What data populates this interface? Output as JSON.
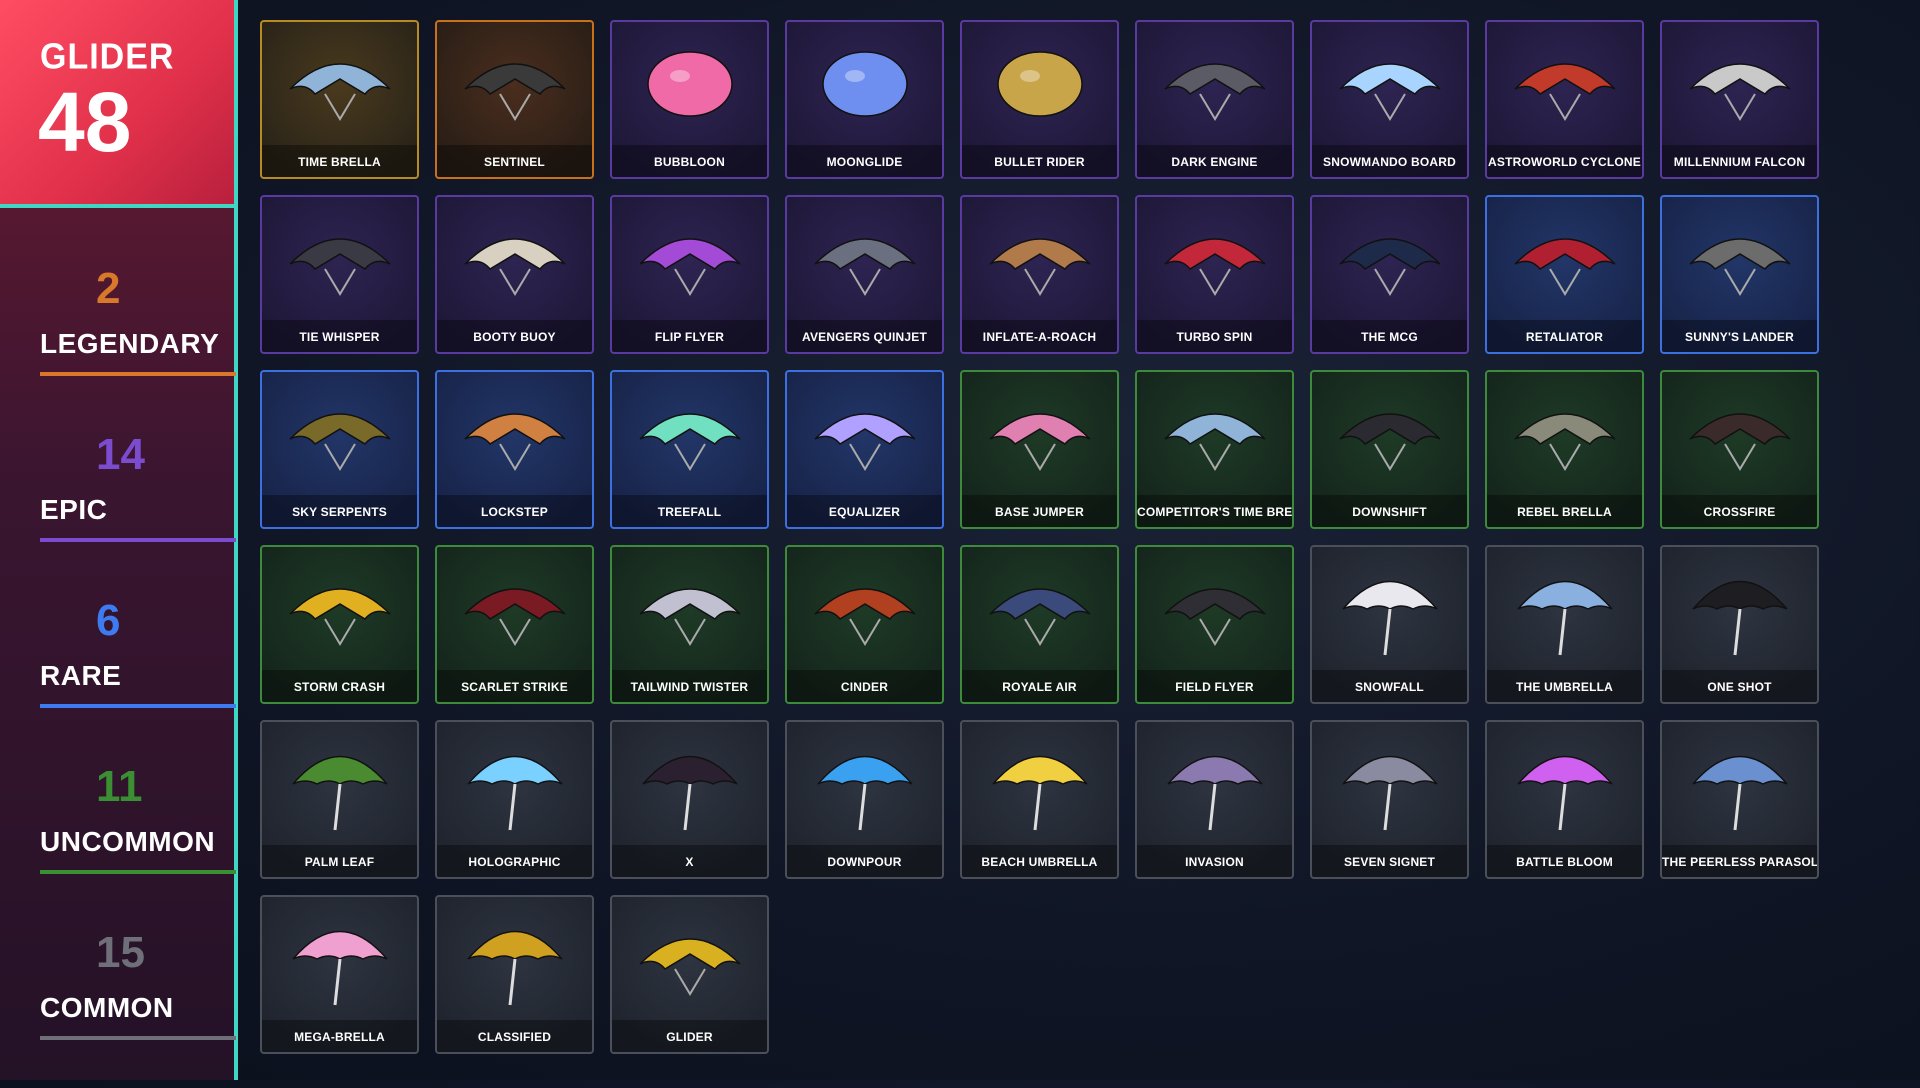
{
  "summary": {
    "category": "GLIDER",
    "total": "48"
  },
  "rarities": [
    {
      "count": "2",
      "name": "LEGENDARY",
      "color": "#d9782a"
    },
    {
      "count": "14",
      "name": "EPIC",
      "color": "#7b4bd0"
    },
    {
      "count": "6",
      "name": "RARE",
      "color": "#3f7bf0"
    },
    {
      "count": "11",
      "name": "UNCOMMON",
      "color": "#3b8f33"
    },
    {
      "count": "15",
      "name": "COMMON",
      "color": "#6f6f7a"
    }
  ],
  "items": [
    {
      "name": "TIME BRELLA",
      "rarity": "legendary",
      "icon": "ufo-glider-icon"
    },
    {
      "name": "SENTINEL",
      "rarity": "legendary2",
      "icon": "mech-spider-icon"
    },
    {
      "name": "BUBBLOON",
      "rarity": "epic",
      "icon": "pink-balloon-icon"
    },
    {
      "name": "MOONGLIDE",
      "rarity": "epic",
      "icon": "crescent-moon-icon"
    },
    {
      "name": "BULLET RIDER",
      "rarity": "epic",
      "icon": "bullets-icon"
    },
    {
      "name": "DARK ENGINE",
      "rarity": "epic",
      "icon": "train-icon"
    },
    {
      "name": "SNOWMANDO BOARD",
      "rarity": "epic",
      "icon": "snowboard-icon"
    },
    {
      "name": "ASTROWORLD CYCLONE",
      "rarity": "epic",
      "icon": "ride-cart-icon"
    },
    {
      "name": "MILLENNIUM FALCON",
      "rarity": "epic",
      "icon": "falcon-ship-icon"
    },
    {
      "name": "TIE WHISPER",
      "rarity": "epic",
      "icon": "tie-fighter-icon"
    },
    {
      "name": "BOOTY BUOY",
      "rarity": "epic",
      "icon": "octopus-chute-icon"
    },
    {
      "name": "FLIP FLYER",
      "rarity": "epic",
      "icon": "twin-blades-icon"
    },
    {
      "name": "AVENGERS QUINJET",
      "rarity": "epic",
      "icon": "jet-icon"
    },
    {
      "name": "INFLATE-A-ROACH",
      "rarity": "epic",
      "icon": "inflatable-horse-icon"
    },
    {
      "name": "TURBO SPIN",
      "rarity": "epic",
      "icon": "red-jet-icon"
    },
    {
      "name": "THE MCG",
      "rarity": "epic",
      "icon": "wing-glider-icon"
    },
    {
      "name": "RETALIATOR",
      "rarity": "rare",
      "icon": "red-wing-icon"
    },
    {
      "name": "SUNNY'S LANDER",
      "rarity": "rare",
      "icon": "flower-glider-icon"
    },
    {
      "name": "SKY SERPENTS",
      "rarity": "rare",
      "icon": "serpent-icon"
    },
    {
      "name": "LOCKSTEP",
      "rarity": "rare",
      "icon": "plank-glider-icon"
    },
    {
      "name": "TREEFALL",
      "rarity": "rare",
      "icon": "leaf-glider-icon"
    },
    {
      "name": "EQUALIZER",
      "rarity": "rare",
      "icon": "striped-glider-icon"
    },
    {
      "name": "BASE JUMPER",
      "rarity": "uncommon",
      "icon": "hang-glider-icon"
    },
    {
      "name": "COMPETITOR'S TIME BRELLA",
      "rarity": "uncommon",
      "icon": "ufo-glider-icon"
    },
    {
      "name": "DOWNSHIFT",
      "rarity": "uncommon",
      "icon": "black-glider-icon"
    },
    {
      "name": "REBEL BRELLA",
      "rarity": "uncommon",
      "icon": "round-brella-icon"
    },
    {
      "name": "CROSSFIRE",
      "rarity": "uncommon",
      "icon": "dark-glider-icon"
    },
    {
      "name": "STORM CRASH",
      "rarity": "uncommon",
      "icon": "yellow-glider-icon"
    },
    {
      "name": "SCARLET STRIKE",
      "rarity": "uncommon",
      "icon": "red-black-glider-icon"
    },
    {
      "name": "TAILWIND TWISTER",
      "rarity": "uncommon",
      "icon": "purple-white-glider-icon"
    },
    {
      "name": "CINDER",
      "rarity": "uncommon",
      "icon": "lava-glider-icon"
    },
    {
      "name": "ROYALE AIR",
      "rarity": "uncommon",
      "icon": "blue-glider-icon"
    },
    {
      "name": "FIELD FLYER",
      "rarity": "uncommon",
      "icon": "black-white-glider-icon"
    },
    {
      "name": "SNOWFALL",
      "rarity": "common",
      "icon": "snow-umbrella-icon"
    },
    {
      "name": "THE UMBRELLA",
      "rarity": "common",
      "icon": "umbrella-icon"
    },
    {
      "name": "ONE SHOT",
      "rarity": "common",
      "icon": "black-umbrella-icon"
    },
    {
      "name": "PALM LEAF",
      "rarity": "common",
      "icon": "palm-leaf-icon"
    },
    {
      "name": "HOLOGRAPHIC",
      "rarity": "common",
      "icon": "holo-umbrella-icon"
    },
    {
      "name": "X",
      "rarity": "common",
      "icon": "dark-umbrella-icon"
    },
    {
      "name": "DOWNPOUR",
      "rarity": "common",
      "icon": "water-umbrella-icon"
    },
    {
      "name": "BEACH UMBRELLA",
      "rarity": "common",
      "icon": "beach-umbrella-icon"
    },
    {
      "name": "INVASION",
      "rarity": "common",
      "icon": "ufo-umbrella-icon"
    },
    {
      "name": "SEVEN SIGNET",
      "rarity": "common",
      "icon": "signet-umbrella-icon"
    },
    {
      "name": "BATTLE BLOOM",
      "rarity": "common",
      "icon": "bloom-umbrella-icon"
    },
    {
      "name": "THE PEERLESS PARASOL",
      "rarity": "common",
      "icon": "parasol-icon"
    },
    {
      "name": "MEGA-BRELLA",
      "rarity": "common",
      "icon": "pink-umbrella-icon"
    },
    {
      "name": "CLASSIFIED",
      "rarity": "common",
      "icon": "gold-umbrella-icon"
    },
    {
      "name": "GLIDER",
      "rarity": "common",
      "icon": "default-glider-icon"
    }
  ]
}
